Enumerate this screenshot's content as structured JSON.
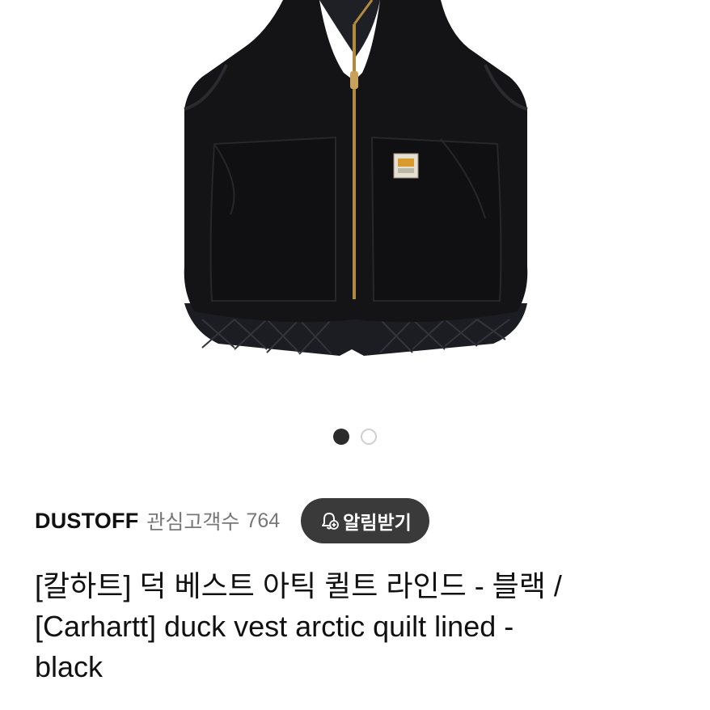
{
  "product": {
    "image_alt_icon": "vest-product-image",
    "carousel": {
      "total": 2,
      "active_index": 0
    },
    "seller": {
      "name": "DUSTOFF",
      "follower_label": "관심고객수",
      "follower_count": "764"
    },
    "alert_button": {
      "label": "알림받기",
      "icon": "bell-plus-icon"
    },
    "title_lines": [
      "[칼하트] 덕 베스트 아틱 퀼트 라인드 - 블랙 /",
      "[Carhartt] duck vest arctic quilt lined -",
      "black"
    ]
  },
  "colors": {
    "background": "#ffffff",
    "text": "#111111",
    "muted": "#777777",
    "button_bg": "#3a3a3a",
    "dot_active": "#2b2b2b",
    "dot_inactive_border": "#d0d0d0",
    "vest": "#141416"
  }
}
